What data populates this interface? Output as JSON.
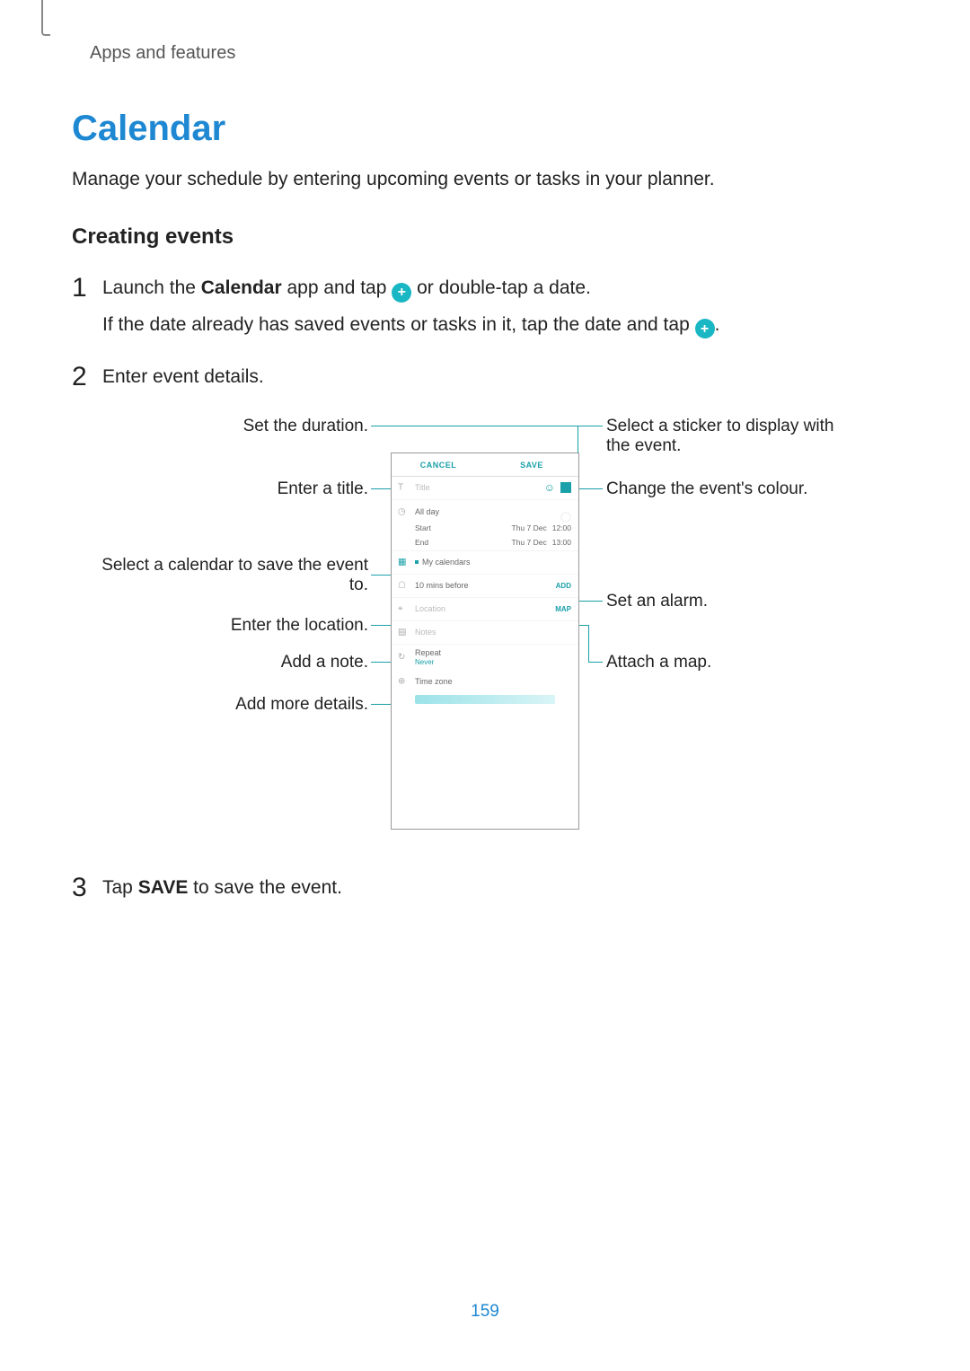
{
  "breadcrumb": "Apps and features",
  "title": "Calendar",
  "intro": "Manage your schedule by entering upcoming events or tasks in your planner.",
  "subhead": "Creating events",
  "page_number": "159",
  "steps": {
    "s1": {
      "num": "1",
      "line1_a": "Launch the ",
      "line1_bold": "Calendar",
      "line1_b": " app and tap ",
      "line1_c": " or double-tap a date.",
      "line2_a": "If the date already has saved events or tasks in it, tap the date and tap ",
      "line2_b": "."
    },
    "s2": {
      "num": "2",
      "text": "Enter event details."
    },
    "s3": {
      "num": "3",
      "a": "Tap ",
      "bold": "SAVE",
      "b": " to save the event."
    }
  },
  "callouts": {
    "left": {
      "duration": "Set the duration.",
      "title": "Enter a title.",
      "calendar": "Select a calendar to save the event to.",
      "location": "Enter the location.",
      "note": "Add a note.",
      "more": "Add more details."
    },
    "right": {
      "sticker": "Select a sticker to display with the event.",
      "colour": "Change the event's colour.",
      "alarm": "Set an alarm.",
      "map": "Attach a map."
    }
  },
  "phone": {
    "cancel": "CANCEL",
    "save": "SAVE",
    "title_placeholder": "Title",
    "allday": "All day",
    "start_label": "Start",
    "end_label": "End",
    "start_date": "Thu 7 Dec",
    "start_time": "12:00",
    "end_date": "Thu 7 Dec",
    "end_time": "13:00",
    "my_calendars": "My calendars",
    "reminder": "10 mins before",
    "add_btn": "ADD",
    "location_placeholder": "Location",
    "map_btn": "MAP",
    "notes_placeholder": "Notes",
    "repeat": "Repeat",
    "repeat_value": "Never",
    "timezone": "Time zone"
  }
}
